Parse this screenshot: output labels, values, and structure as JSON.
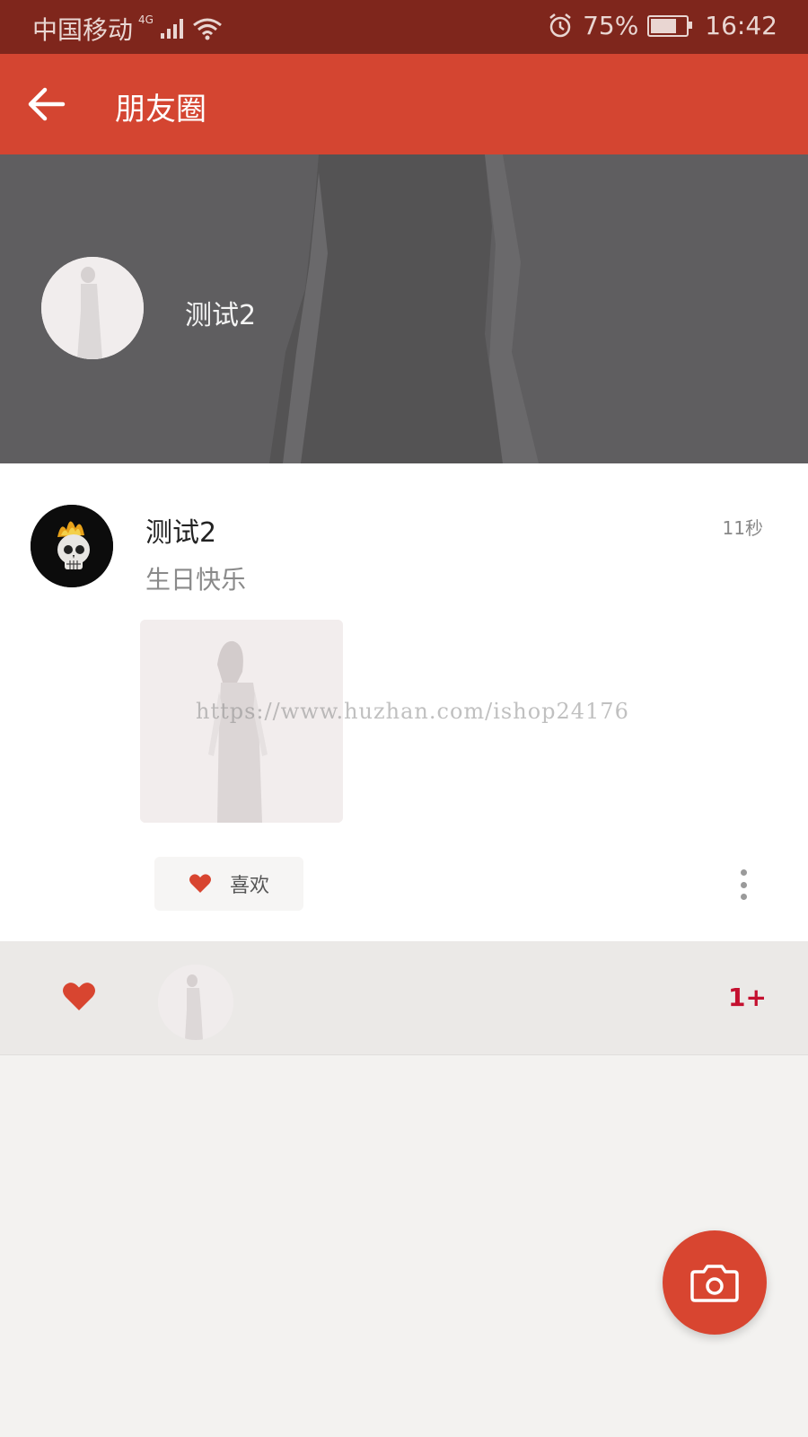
{
  "status_bar": {
    "carrier": "中国移动",
    "network": "4G",
    "battery": "75%",
    "time": "16:42",
    "icons": [
      "signal-icon",
      "wifi-icon",
      "alarm-icon",
      "battery-icon"
    ]
  },
  "toolbar": {
    "title": "朋友圈",
    "back_icon": "arrow-left-icon"
  },
  "cover": {
    "user_name": "测试2"
  },
  "post": {
    "author": "测试2",
    "time": "11秒",
    "text": "生日快乐",
    "watermark": "https://www.huzhan.com/ishop24176",
    "like_label": "喜欢",
    "more_icon": "more-vertical-icon"
  },
  "likes": {
    "count": "1+"
  },
  "colors": {
    "status_bar": "#7f261c",
    "toolbar": "#d44531",
    "accent": "#d84530",
    "likes_count": "#c4102f"
  }
}
